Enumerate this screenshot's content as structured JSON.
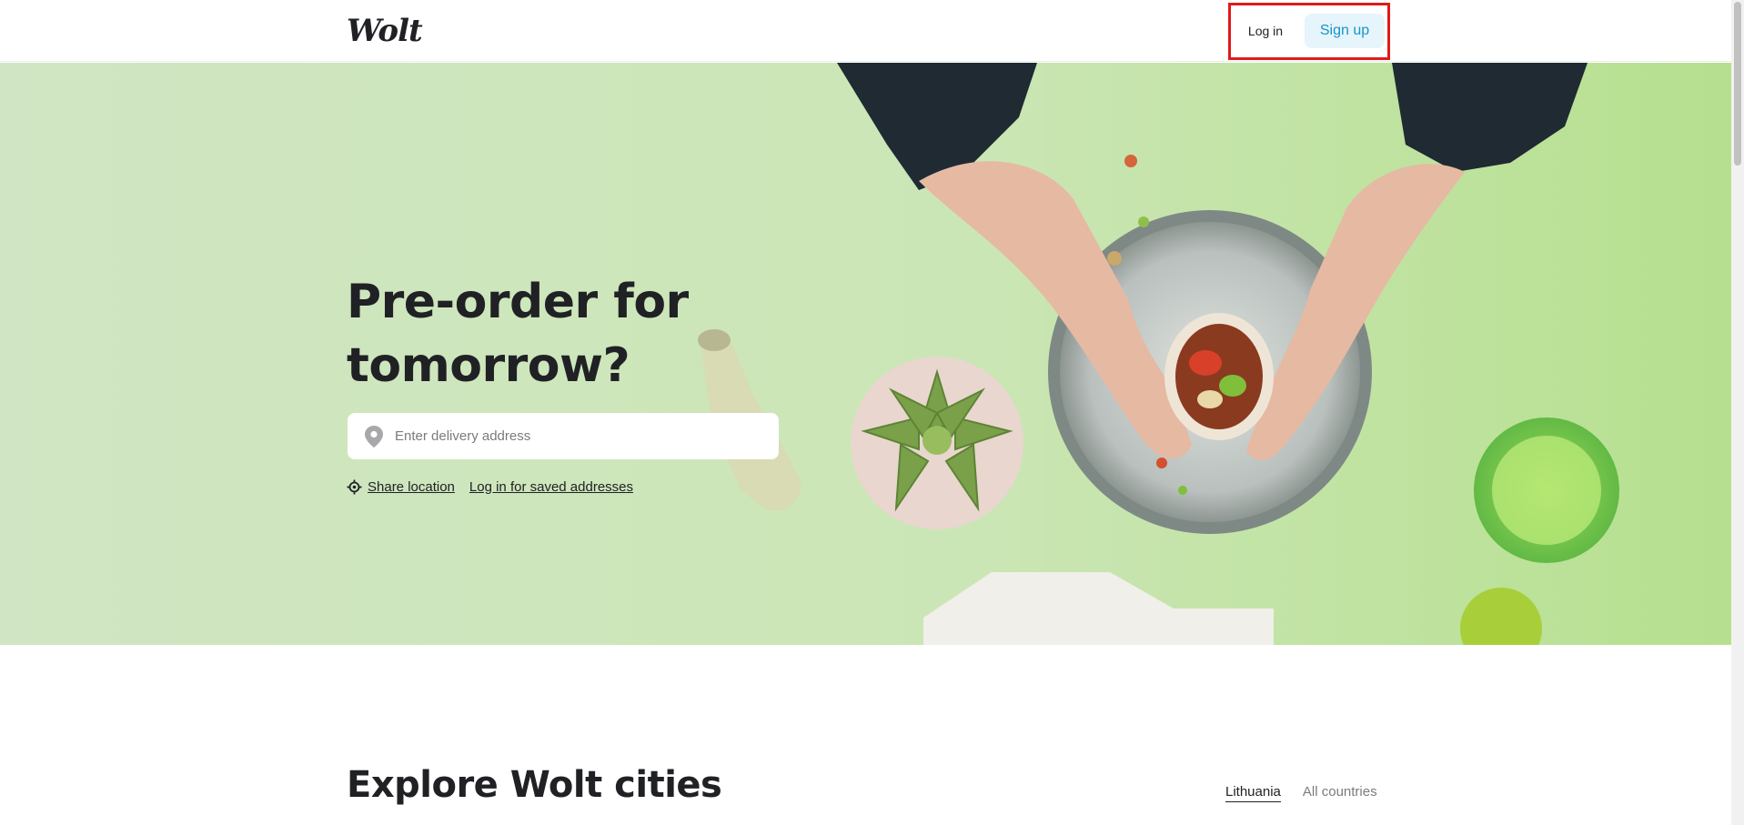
{
  "header": {
    "logo": "Wolt",
    "login_label": "Log in",
    "signup_label": "Sign up"
  },
  "hero": {
    "title_line1": "Pre-order for",
    "title_line2": "tomorrow?",
    "address_placeholder": "Enter delivery address",
    "share_location_label": "Share location",
    "saved_addresses_label": "Log in for saved addresses"
  },
  "explore": {
    "title": "Explore Wolt cities",
    "tabs": [
      {
        "label": "Lithuania",
        "active": true
      },
      {
        "label": "All countries",
        "active": false
      }
    ]
  },
  "icons": {
    "location_pin": "map-pin-icon",
    "share_location": "crosshair-icon"
  },
  "colors": {
    "hero_bg": "#cfe5c2",
    "signup_text": "#1596c9",
    "signup_bg": "#e6f4fb",
    "highlight_box": "#e11a1a"
  }
}
